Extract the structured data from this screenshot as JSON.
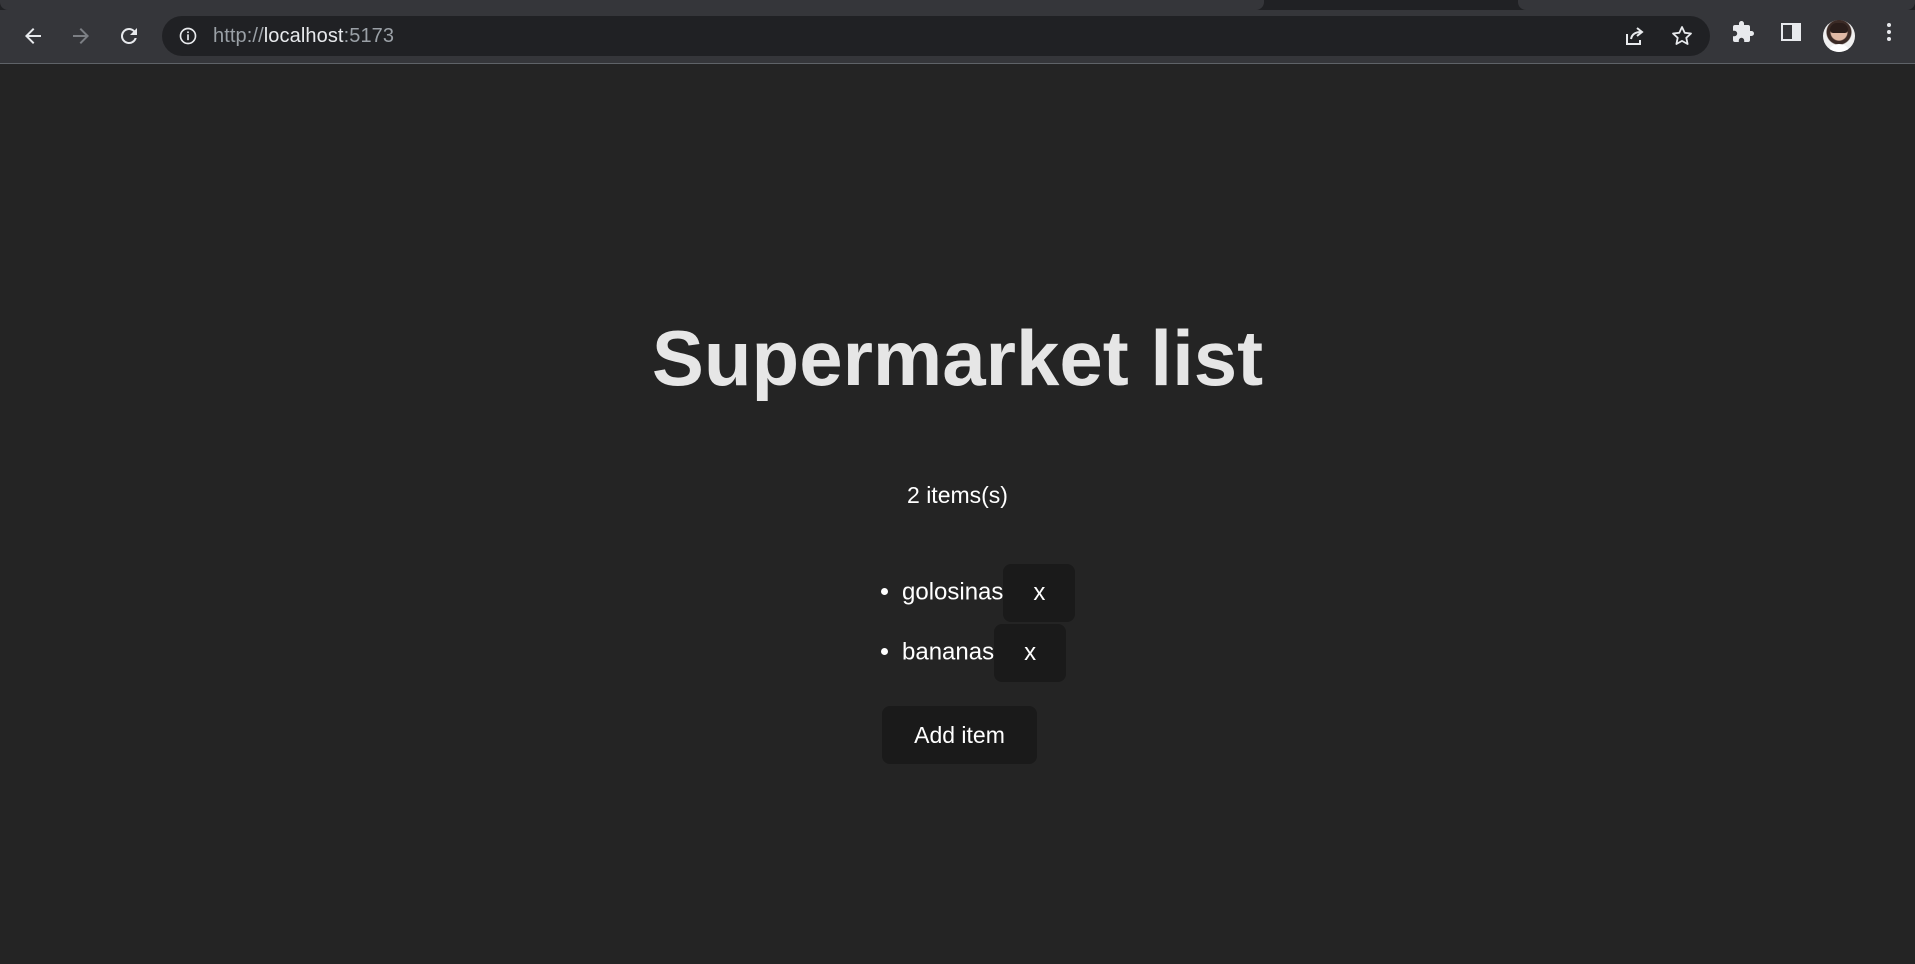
{
  "browser": {
    "url_scheme": "http://",
    "url_host": "localhost",
    "url_port": ":5173"
  },
  "page": {
    "title": "Supermarket list",
    "count_text": "2 items(s)",
    "items": [
      {
        "label": "golosinas",
        "remove_label": "x"
      },
      {
        "label": "bananas",
        "remove_label": "x"
      }
    ],
    "add_button_label": "Add item"
  },
  "colors": {
    "background": "#242424",
    "button_bg": "#1a1a1a",
    "title": "#e6e6e6"
  }
}
